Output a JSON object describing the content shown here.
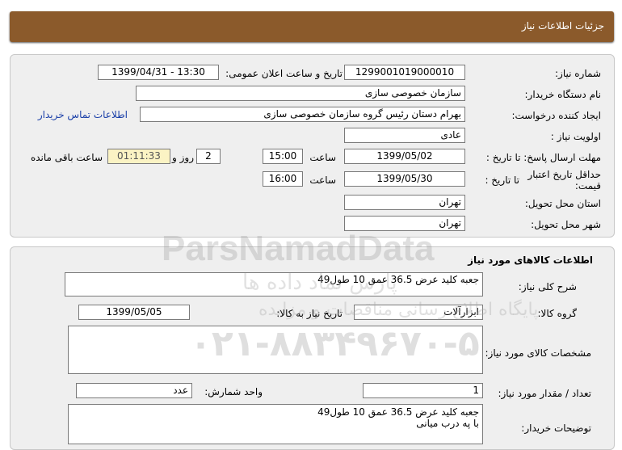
{
  "header": {
    "title": "جزئیات اطلاعات نیاز"
  },
  "need_info": {
    "need_number_label": "شماره نیاز:",
    "need_number": "1299001019000010",
    "announce_label": "تاریخ و ساعت اعلان عمومی:",
    "announce_value": "1399/04/31 - 13:30",
    "buyer_org_label": "نام دستگاه خریدار:",
    "buyer_org": "سازمان خصوصی سازی",
    "creator_label": "ایجاد کننده درخواست:",
    "creator": "بهرام دستان رئیس گروه سازمان خصوصی سازی",
    "contact_link": "اطلاعات تماس خریدار",
    "priority_label": "اولویت نیاز :",
    "priority": "عادی",
    "deadline_label": "مهلت ارسال پاسخ: تا تاریخ :",
    "deadline_date": "1399/05/02",
    "time_label": "ساعت",
    "deadline_time": "15:00",
    "days_value": "2",
    "days_label": "روز و",
    "remaining_time": "01:11:33",
    "remaining_label": "ساعت باقی مانده",
    "validity_label": "حداقل تاریخ اعتبار قیمت:",
    "validity_to_label": "تا تاریخ :",
    "validity_date": "1399/05/30",
    "validity_time_label": "ساعت",
    "validity_time": "16:00",
    "province_label": "استان محل تحویل:",
    "province": "تهران",
    "city_label": "شهر محل تحویل:",
    "city": "تهران"
  },
  "goods": {
    "section_title": "اطلاعات کالاهای مورد نیاز",
    "summary_label": "شرح کلی نیاز:",
    "summary": "جعبه کلید   عرض 36.5   عمق 10   طول49",
    "group_label": "گروه کالا:",
    "group": "ابزارآلات",
    "need_date_label": "تاریخ نیاز به کالا:",
    "need_date": "1399/05/05",
    "specs_label": "مشخصات کالای مورد نیاز:",
    "specs": "",
    "qty_label": "تعداد / مقدار مورد نیاز:",
    "qty": "1",
    "unit_label": "واحد شمارش:",
    "unit": "عدد",
    "desc_label": "توضیحات خریدار:",
    "desc_line1": "جعبه کلید عرض 36.5   عمق 10   طول49",
    "desc_line2": "با په درب میانی"
  },
  "watermark": {
    "brand": "ParsNamadData",
    "brand_fa": "پارس نماد داده ها",
    "tagline": "پایگاه اطلاع رسانی مناقصات و مزایده",
    "phone": "۰۲۱-۸۸۳۴۹۶۷۰-۵"
  }
}
